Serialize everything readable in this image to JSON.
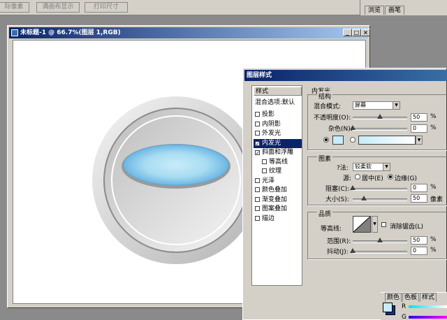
{
  "toolbar": {
    "buttons": [
      "际像素",
      "满画布显示",
      "打印尺寸"
    ]
  },
  "palette_tabs": [
    "浏览",
    "画笔"
  ],
  "document": {
    "title": "未标题-1 @ 66.7%(图层 1,RGB)",
    "min_btn": "_",
    "max_btn": "□",
    "close_btn": "×"
  },
  "dialog": {
    "title": "图层样式",
    "styles_header": "样式",
    "blend_options": "混合选项:默认",
    "style_items": [
      {
        "label": "投影",
        "checked": false,
        "selected": false,
        "indent": false
      },
      {
        "label": "内阴影",
        "checked": false,
        "selected": false,
        "indent": false
      },
      {
        "label": "外发光",
        "checked": false,
        "selected": false,
        "indent": false
      },
      {
        "label": "内发光",
        "checked": true,
        "selected": true,
        "indent": false
      },
      {
        "label": "斜面和浮雕",
        "checked": true,
        "selected": false,
        "indent": false
      },
      {
        "label": "等高线",
        "checked": false,
        "selected": false,
        "indent": true
      },
      {
        "label": "纹理",
        "checked": false,
        "selected": false,
        "indent": true
      },
      {
        "label": "光泽",
        "checked": false,
        "selected": false,
        "indent": false
      },
      {
        "label": "颜色叠加",
        "checked": false,
        "selected": false,
        "indent": false
      },
      {
        "label": "渐变叠加",
        "checked": false,
        "selected": false,
        "indent": false
      },
      {
        "label": "图案叠加",
        "checked": false,
        "selected": false,
        "indent": false
      },
      {
        "label": "描边",
        "checked": false,
        "selected": false,
        "indent": false
      }
    ],
    "panel_title": "内发光",
    "structure": {
      "title": "结构",
      "blend_mode_label": "混合模式:",
      "blend_mode_value": "屏幕",
      "opacity_label": "不透明度(O):",
      "opacity_value": "50",
      "opacity_fraction": 0.5,
      "noise_label": "杂色(N):",
      "noise_value": "0",
      "noise_fraction": 0.0,
      "unit_percent": "%",
      "glow_color": "#c8ecfa"
    },
    "elements": {
      "title": "图素",
      "method_label": "?法:",
      "method_value": "较柔软",
      "source_label": "源:",
      "source_center": "居中(E)",
      "source_edge": "边缘(G)",
      "source_selected": "edge",
      "choke_label": "阻塞(C):",
      "choke_value": "0",
      "choke_fraction": 0.0,
      "size_label": "大小(S):",
      "size_value": "50",
      "size_fraction": 0.2,
      "unit_pixels": "像素"
    },
    "quality": {
      "title": "品质",
      "contour_label": "等高线:",
      "antialias_label": "消除锯齿(L)",
      "range_label": "范围(R):",
      "range_value": "50",
      "range_fraction": 0.5,
      "jitter_label": "抖动(J):",
      "jitter_value": "0",
      "jitter_fraction": 0.0
    }
  },
  "color_palette": {
    "tabs": [
      "颜色",
      "色板",
      "样式"
    ],
    "r_label": "R",
    "g_label": "G"
  },
  "colors": {
    "title_bar": "#0a246a",
    "chrome": "#d4d0c8",
    "workspace": "#8a8a8a"
  }
}
